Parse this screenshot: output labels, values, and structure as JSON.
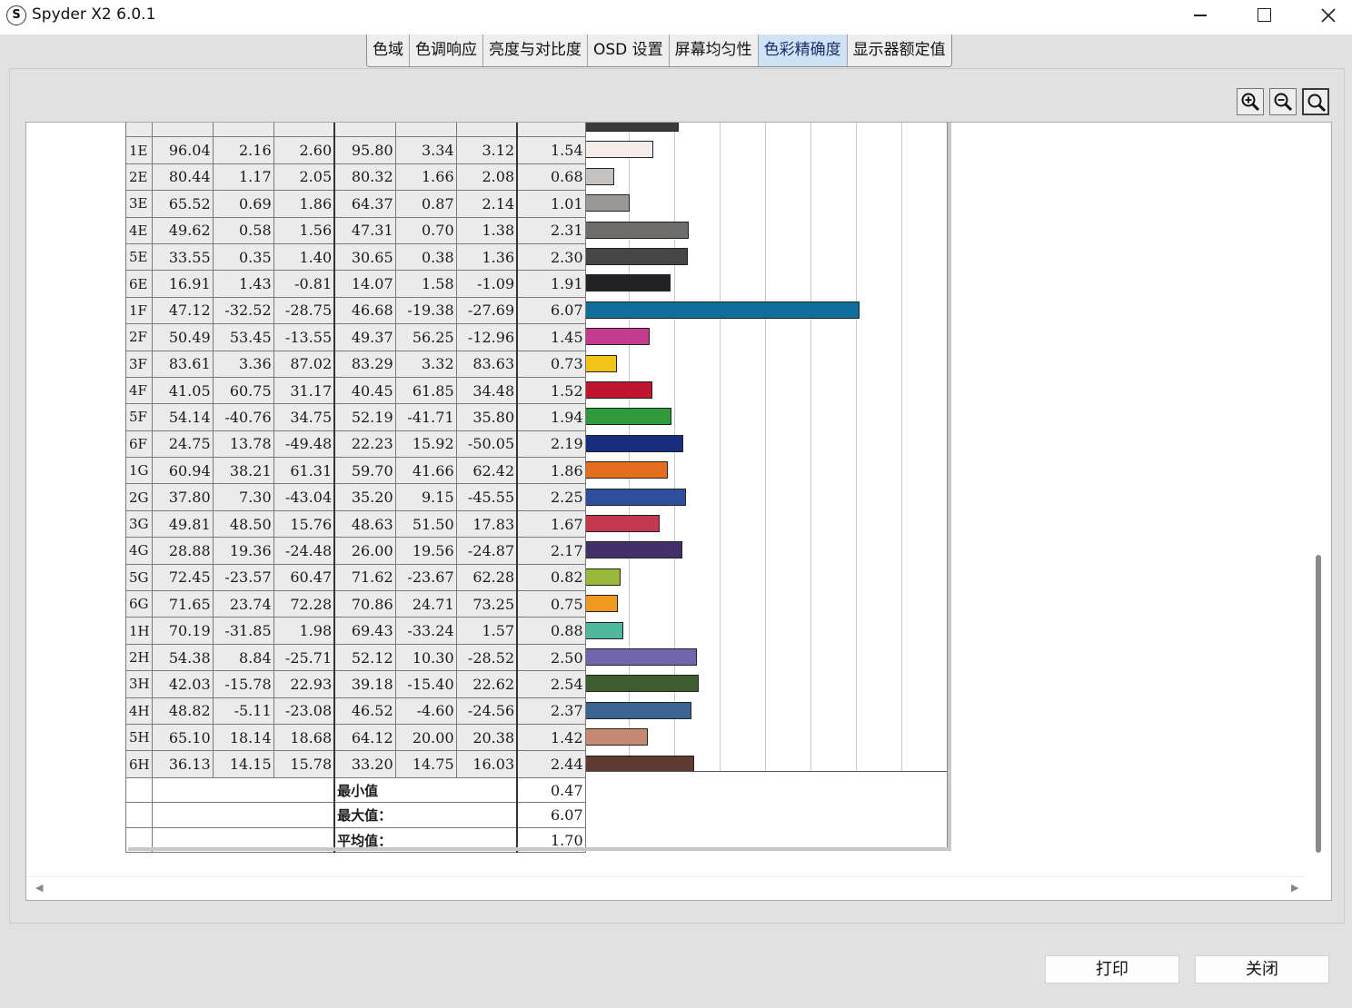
{
  "window": {
    "app_logo": "S",
    "title": "Spyder X2 6.0.1",
    "controls": {
      "minimize_icon": "minimize-icon",
      "maximize_icon": "maximize-icon",
      "close_icon": "close-icon"
    }
  },
  "tabs": [
    {
      "label": "色域",
      "active": false
    },
    {
      "label": "色调响应",
      "active": false
    },
    {
      "label": "亮度与对比度",
      "active": false
    },
    {
      "label": "OSD 设置",
      "active": false
    },
    {
      "label": "屏幕均匀性",
      "active": false
    },
    {
      "label": "色彩精确度",
      "active": true
    },
    {
      "label": "显示器额定值",
      "active": false
    }
  ],
  "toolbar": {
    "zoom_in_icon": "zoom-in-icon",
    "zoom_out_icon": "zoom-out-icon",
    "zoom_fit_icon": "zoom-fit-icon"
  },
  "report": {
    "rows": [
      {
        "id": "1E",
        "v": [
          "96.04",
          "2.16",
          "2.60",
          "95.80",
          "3.34",
          "3.12"
        ],
        "de": "1.54",
        "color": "#f6ecea"
      },
      {
        "id": "2E",
        "v": [
          "80.44",
          "1.17",
          "2.05",
          "80.32",
          "1.66",
          "2.08"
        ],
        "de": "0.68",
        "color": "#c5c3c1"
      },
      {
        "id": "3E",
        "v": [
          "65.52",
          "0.69",
          "1.86",
          "64.37",
          "0.87",
          "2.14"
        ],
        "de": "1.01",
        "color": "#9a9998"
      },
      {
        "id": "4E",
        "v": [
          "49.62",
          "0.58",
          "1.56",
          "47.31",
          "0.70",
          "1.38"
        ],
        "de": "2.31",
        "color": "#6e6d6c"
      },
      {
        "id": "5E",
        "v": [
          "33.55",
          "0.35",
          "1.40",
          "30.65",
          "0.38",
          "1.36"
        ],
        "de": "2.30",
        "color": "#474646"
      },
      {
        "id": "6E",
        "v": [
          "16.91",
          "1.43",
          "-0.81",
          "14.07",
          "1.58",
          "-1.09"
        ],
        "de": "1.91",
        "color": "#222224"
      },
      {
        "id": "1F",
        "v": [
          "47.12",
          "-32.52",
          "-28.75",
          "46.68",
          "-19.38",
          "-27.69"
        ],
        "de": "6.07",
        "color": "#0f6e9a"
      },
      {
        "id": "2F",
        "v": [
          "50.49",
          "53.45",
          "-13.55",
          "49.37",
          "56.25",
          "-12.96"
        ],
        "de": "1.45",
        "color": "#c43b8f"
      },
      {
        "id": "3F",
        "v": [
          "83.61",
          "3.36",
          "87.02",
          "83.29",
          "3.32",
          "83.63"
        ],
        "de": "0.73",
        "color": "#f0c415"
      },
      {
        "id": "4F",
        "v": [
          "41.05",
          "60.75",
          "31.17",
          "40.45",
          "61.85",
          "34.48"
        ],
        "de": "1.52",
        "color": "#c0152f"
      },
      {
        "id": "5F",
        "v": [
          "54.14",
          "-40.76",
          "34.75",
          "52.19",
          "-41.71",
          "35.80"
        ],
        "de": "1.94",
        "color": "#2f9a3b"
      },
      {
        "id": "6F",
        "v": [
          "24.75",
          "13.78",
          "-49.48",
          "22.23",
          "15.92",
          "-50.05"
        ],
        "de": "2.19",
        "color": "#1a2e7f"
      },
      {
        "id": "1G",
        "v": [
          "60.94",
          "38.21",
          "61.31",
          "59.70",
          "41.66",
          "62.42"
        ],
        "de": "1.86",
        "color": "#e56e1e"
      },
      {
        "id": "2G",
        "v": [
          "37.80",
          "7.30",
          "-43.04",
          "35.20",
          "9.15",
          "-45.55"
        ],
        "de": "2.25",
        "color": "#2e4e9c"
      },
      {
        "id": "3G",
        "v": [
          "49.81",
          "48.50",
          "15.76",
          "48.63",
          "51.50",
          "17.83"
        ],
        "de": "1.67",
        "color": "#c3384f"
      },
      {
        "id": "4G",
        "v": [
          "28.88",
          "19.36",
          "-24.48",
          "26.00",
          "19.56",
          "-24.87"
        ],
        "de": "2.17",
        "color": "#42306a"
      },
      {
        "id": "5G",
        "v": [
          "72.45",
          "-23.57",
          "60.47",
          "71.62",
          "-23.67",
          "62.28"
        ],
        "de": "0.82",
        "color": "#9ab93a"
      },
      {
        "id": "6G",
        "v": [
          "71.65",
          "23.74",
          "72.28",
          "70.86",
          "24.71",
          "73.25"
        ],
        "de": "0.75",
        "color": "#ee9a1e"
      },
      {
        "id": "1H",
        "v": [
          "70.19",
          "-31.85",
          "1.98",
          "69.43",
          "-33.24",
          "1.57"
        ],
        "de": "0.88",
        "color": "#4fb79e"
      },
      {
        "id": "2H",
        "v": [
          "54.38",
          "8.84",
          "-25.71",
          "52.12",
          "10.30",
          "-28.52"
        ],
        "de": "2.50",
        "color": "#7067ad"
      },
      {
        "id": "3H",
        "v": [
          "42.03",
          "-15.78",
          "22.93",
          "39.18",
          "-15.40",
          "22.62"
        ],
        "de": "2.54",
        "color": "#3d5e30"
      },
      {
        "id": "4H",
        "v": [
          "48.82",
          "-5.11",
          "-23.08",
          "46.52",
          "-4.60",
          "-24.56"
        ],
        "de": "2.37",
        "color": "#3b6593"
      },
      {
        "id": "5H",
        "v": [
          "65.10",
          "18.14",
          "18.68",
          "64.12",
          "20.00",
          "20.38"
        ],
        "de": "1.42",
        "color": "#c48a74"
      },
      {
        "id": "6H",
        "v": [
          "36.13",
          "14.15",
          "15.78",
          "33.20",
          "14.75",
          "16.03"
        ],
        "de": "2.44",
        "color": "#5e3a30"
      }
    ],
    "summary": [
      {
        "label": "最小值",
        "value": "0.47"
      },
      {
        "label": "最大值：",
        "value": "6.07"
      },
      {
        "label": "平均值：",
        "value": "1.70"
      }
    ]
  },
  "chart_data": {
    "type": "bar",
    "orientation": "horizontal",
    "categories": [
      "1E",
      "2E",
      "3E",
      "4E",
      "5E",
      "6E",
      "1F",
      "2F",
      "3F",
      "4F",
      "5F",
      "6F",
      "1G",
      "2G",
      "3G",
      "4G",
      "5G",
      "6G",
      "1H",
      "2H",
      "3H",
      "4H",
      "5H",
      "6H"
    ],
    "values": [
      1.54,
      0.68,
      1.01,
      2.31,
      2.3,
      1.91,
      6.07,
      1.45,
      0.73,
      1.52,
      1.94,
      2.19,
      1.86,
      2.25,
      1.67,
      2.17,
      0.82,
      0.75,
      0.88,
      2.5,
      2.54,
      2.37,
      1.42,
      2.44
    ],
    "xlim": [
      0,
      8
    ],
    "grid": true
  },
  "buttons": {
    "print": "打印",
    "close": "关闭"
  }
}
